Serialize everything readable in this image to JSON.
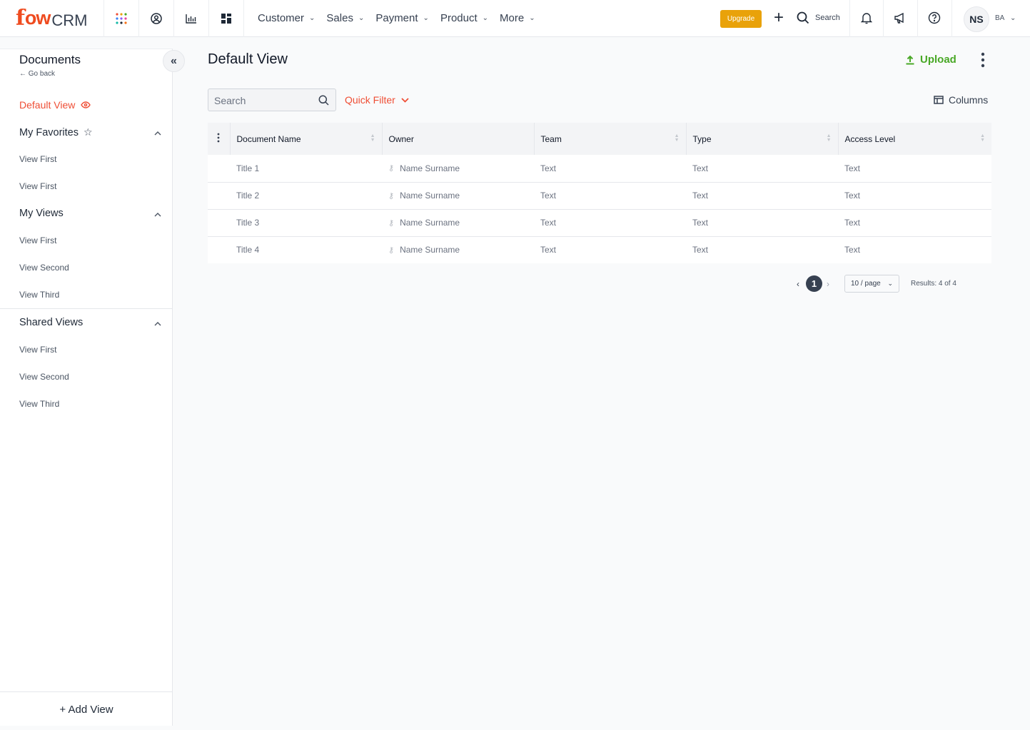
{
  "brand": {
    "logo_f": "f",
    "logo_ow": "ow",
    "logo_crm": "CRM"
  },
  "topnav": {
    "items": [
      "Customer",
      "Sales",
      "Payment",
      "Product",
      "More"
    ],
    "upgrade_label": "Upgrade",
    "search_label": "Search",
    "avatar_initials": "NS",
    "account_code": "BA"
  },
  "sidebar": {
    "title": "Documents",
    "back_label": "← Go back",
    "default_view": "Default View",
    "sections": [
      {
        "label": "My Favorites",
        "items": [
          "View First",
          "View First"
        ]
      },
      {
        "label": "My Views",
        "items": [
          "View First",
          "View Second",
          "View Third"
        ]
      },
      {
        "label": "Shared Views",
        "items": [
          "View First",
          "View Second",
          "View Third"
        ]
      }
    ],
    "add_view_label": "+ Add View"
  },
  "main": {
    "title": "Default View",
    "upload_label": "Upload",
    "search_placeholder": "Search",
    "quick_filter_label": "Quick Filter",
    "columns_label": "Columns"
  },
  "table": {
    "headers": [
      "Document Name",
      "Owner",
      "Team",
      "Type",
      "Access Level"
    ],
    "rows": [
      [
        "Title 1",
        "Name Surname",
        "Text",
        "Text",
        "Text"
      ],
      [
        "Title 2",
        "Name Surname",
        "Text",
        "Text",
        "Text"
      ],
      [
        "Title 3",
        "Name Surname",
        "Text",
        "Text",
        "Text"
      ],
      [
        "Title 4",
        "Name Surname",
        "Text",
        "Text",
        "Text"
      ]
    ]
  },
  "pagination": {
    "current_page": "1",
    "per_page": "10 / page",
    "results": "Results: 4 of 4"
  },
  "colors": {
    "accent": "#ef4e35",
    "upload": "#49a826",
    "upgrade": "#e9a20a"
  },
  "icons": [
    "apps-grid-icon",
    "user-circle-icon",
    "chart-icon",
    "dashboard-icon",
    "plus-icon",
    "search-icon",
    "bell-icon",
    "megaphone-icon",
    "help-icon",
    "collapse-icon",
    "eye-icon",
    "star-icon",
    "chevron-up-icon",
    "upload-icon",
    "more-vertical-icon",
    "columns-icon",
    "key-icon"
  ]
}
